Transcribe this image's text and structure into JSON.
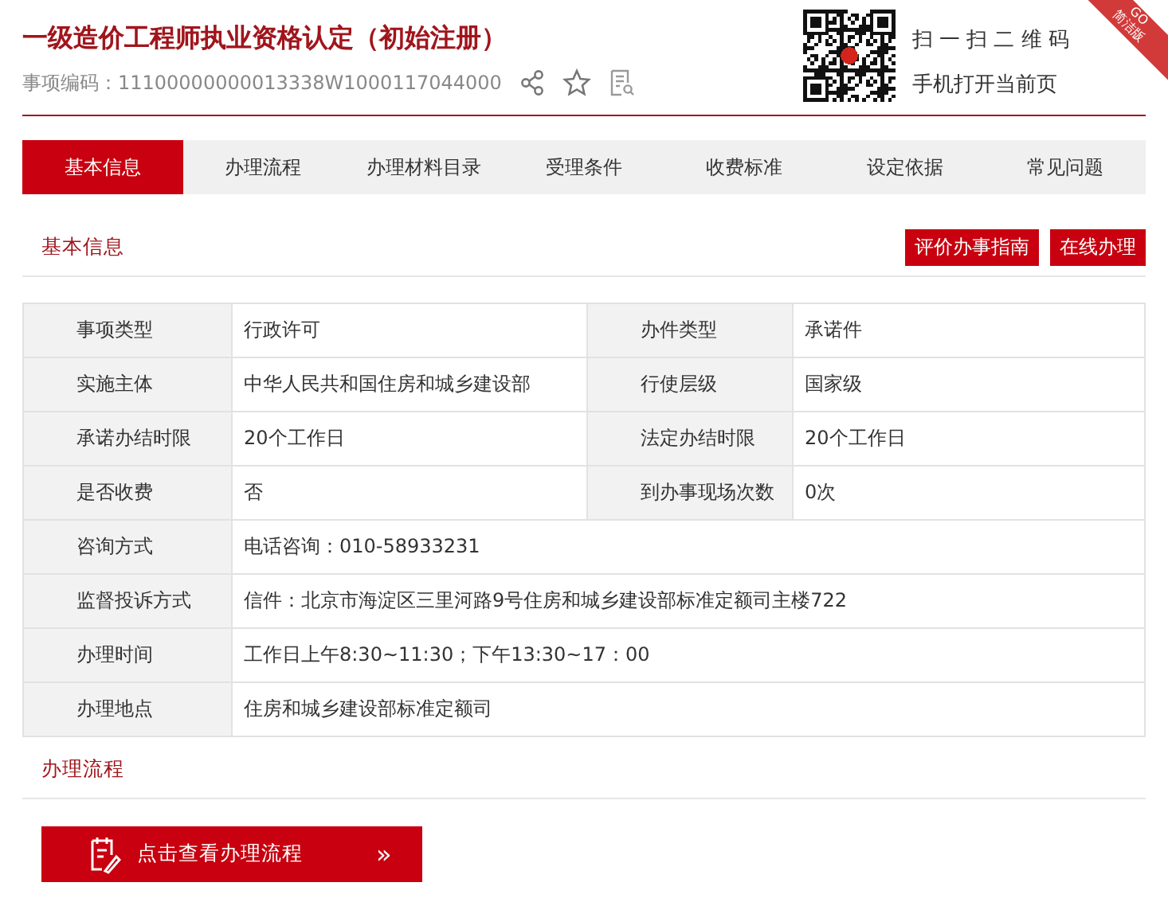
{
  "header": {
    "title": "一级造价工程师执业资格认定（初始注册）",
    "code_label": "事项编码：",
    "code": "11100000000013338W1000117044000",
    "qr_lines": [
      "扫 一 扫 二 维 码",
      "手机打开当前页"
    ],
    "corner_badge": {
      "top": "GO",
      "bottom": "简洁版"
    }
  },
  "tabs": [
    {
      "label": "基本信息",
      "selected": true
    },
    {
      "label": "办理流程",
      "selected": false
    },
    {
      "label": "办理材料目录",
      "selected": false
    },
    {
      "label": "受理条件",
      "selected": false
    },
    {
      "label": "收费标准",
      "selected": false
    },
    {
      "label": "设定依据",
      "selected": false
    },
    {
      "label": "常见问题",
      "selected": false
    }
  ],
  "basic_info": {
    "heading": "基本信息",
    "buttons": [
      "评价办事指南",
      "在线办理"
    ],
    "rows": [
      [
        {
          "label": "事项类型",
          "value": "行政许可"
        },
        {
          "label": "办件类型",
          "value": "承诺件"
        }
      ],
      [
        {
          "label": "实施主体",
          "value": "中华人民共和国住房和城乡建设部"
        },
        {
          "label": "行使层级",
          "value": "国家级"
        }
      ],
      [
        {
          "label": "承诺办结时限",
          "value": "20个工作日"
        },
        {
          "label": "法定办结时限",
          "value": "20个工作日"
        }
      ],
      [
        {
          "label": "是否收费",
          "value": "否"
        },
        {
          "label": "到办事现场次数",
          "value": "0次"
        }
      ],
      [
        {
          "label": "咨询方式",
          "value": "电话咨询：010-58933231"
        }
      ],
      [
        {
          "label": "监督投诉方式",
          "value": "信件：北京市海淀区三里河路9号住房和城乡建设部标准定额司主楼722"
        }
      ],
      [
        {
          "label": "办理时间",
          "value": "工作日上午8:30~11:30；下午13:30~17：00"
        }
      ],
      [
        {
          "label": "办理地点",
          "value": "住房和城乡建设部标准定额司"
        }
      ]
    ]
  },
  "process": {
    "heading": "办理流程",
    "button": "点击查看办理流程",
    "button_arrow": "»"
  }
}
